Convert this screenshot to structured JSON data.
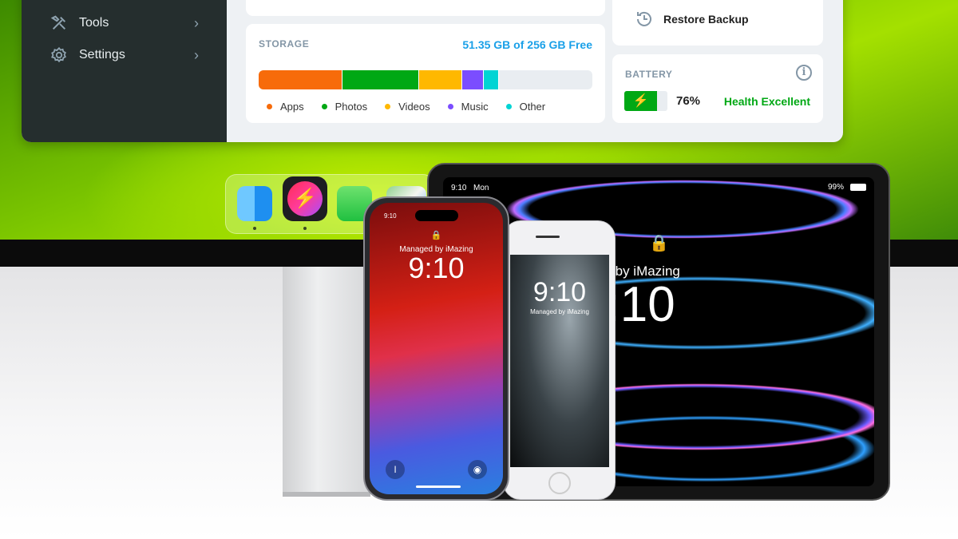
{
  "sidebar": {
    "items": [
      {
        "label": "Tools",
        "icon": "tools-icon"
      },
      {
        "label": "Settings",
        "icon": "gear-icon"
      }
    ]
  },
  "storage": {
    "title": "STORAGE",
    "free_text": "51.35 GB of 256 GB Free",
    "segments": [
      {
        "label": "Apps",
        "color": "#f76b0a",
        "fraction": 0.25
      },
      {
        "label": "Photos",
        "color": "#00a814",
        "fraction": 0.23
      },
      {
        "label": "Videos",
        "color": "#ffb800",
        "fraction": 0.13
      },
      {
        "label": "Music",
        "color": "#7b4dff",
        "fraction": 0.065
      },
      {
        "label": "Other",
        "color": "#00d4d4",
        "fraction": 0.045
      }
    ]
  },
  "restore": {
    "label": "Restore Backup",
    "icon": "restore-clock-icon"
  },
  "battery": {
    "title": "BATTERY",
    "percent": "76%",
    "level": 0.76,
    "health": "Health Excellent",
    "color": "#00a814"
  },
  "dock": {
    "apps": [
      "finder",
      "imazing",
      "messages",
      "maps"
    ]
  },
  "iphone14": {
    "time": "9:10",
    "status_time": "9:10",
    "managed": "Managed by iMazing"
  },
  "iphonese": {
    "time": "9:10",
    "managed": "Managed by iMazing"
  },
  "ipad": {
    "status_time": "9:10",
    "status_day": "Mon",
    "battery": "99%",
    "managed": "Managed by iMazing",
    "time": "9:10"
  },
  "accent": "#1aa0e8"
}
